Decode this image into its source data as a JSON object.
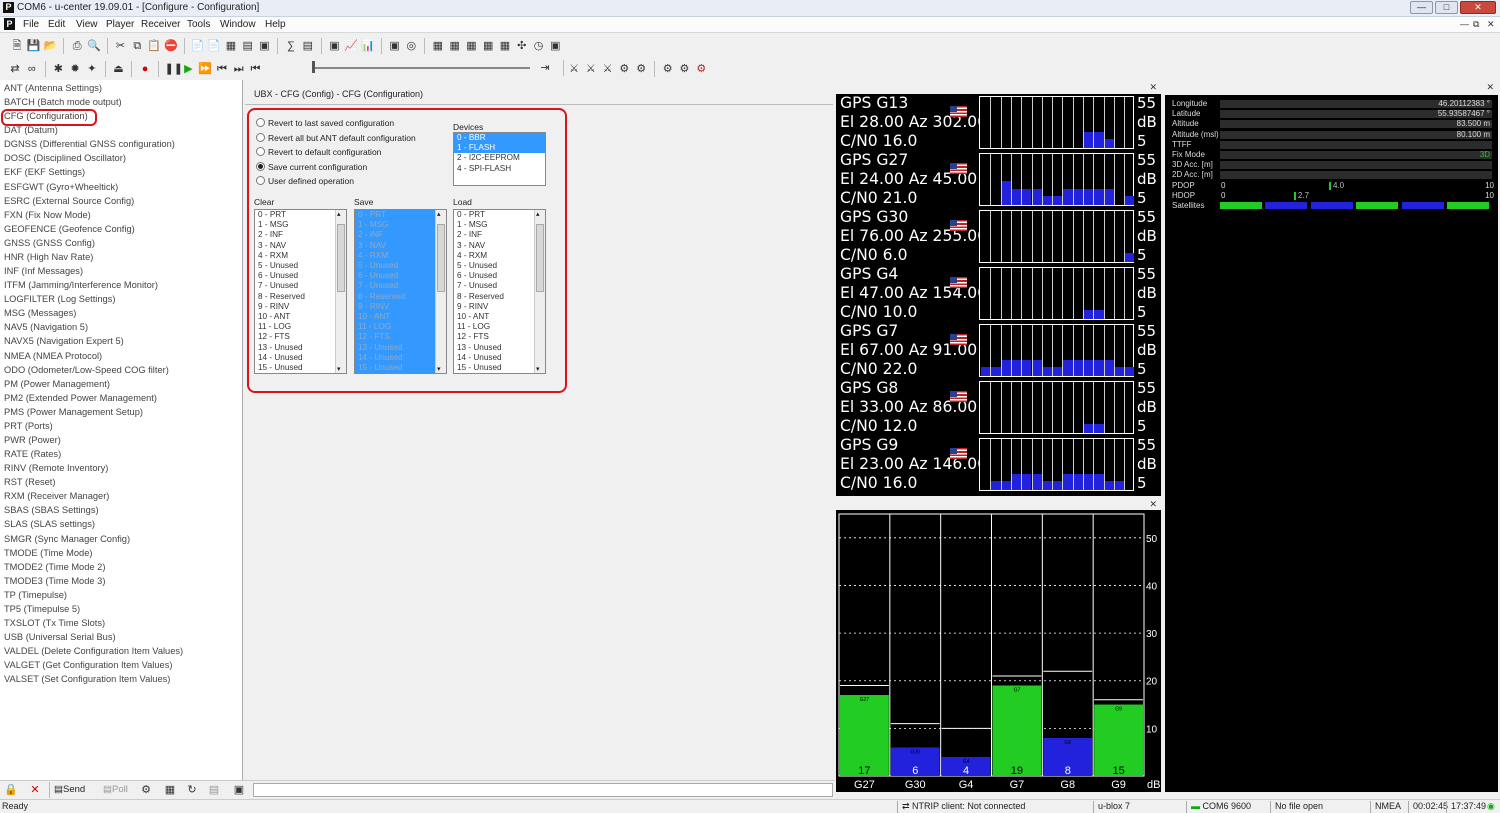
{
  "window": {
    "title": "COM6 - u-center 19.09.01 - [Configure - Configuration]"
  },
  "menu": [
    "File",
    "Edit",
    "View",
    "Player",
    "Receiver",
    "Tools",
    "Window",
    "Help"
  ],
  "tree": [
    "ANT (Antenna Settings)",
    "BATCH (Batch mode output)",
    "CFG (Configuration)",
    "DAT (Datum)",
    "DGNSS (Differential GNSS configuration)",
    "DOSC (Disciplined Oscillator)",
    "EKF (EKF Settings)",
    "ESFGWT (Gyro+Wheeltick)",
    "ESRC (External Source Config)",
    "FXN (Fix Now Mode)",
    "GEOFENCE (Geofence Config)",
    "GNSS (GNSS Config)",
    "HNR (High Nav Rate)",
    "INF (Inf Messages)",
    "ITFM (Jamming/Interference Monitor)",
    "LOGFILTER (Log Settings)",
    "MSG (Messages)",
    "NAV5 (Navigation 5)",
    "NAVX5 (Navigation Expert 5)",
    "NMEA (NMEA Protocol)",
    "ODO (Odometer/Low-Speed COG filter)",
    "PM (Power Management)",
    "PM2 (Extended Power Management)",
    "PMS (Power Management Setup)",
    "PRT (Ports)",
    "PWR (Power)",
    "RATE (Rates)",
    "RINV (Remote Inventory)",
    "RST (Reset)",
    "RXM (Receiver Manager)",
    "SBAS (SBAS Settings)",
    "SLAS (SLAS settings)",
    "SMGR (Sync Manager Config)",
    "TMODE (Time Mode)",
    "TMODE2 (Time Mode 2)",
    "TMODE3 (Time Mode 3)",
    "TP (Timepulse)",
    "TP5 (Timepulse 5)",
    "TXSLOT (Tx Time Slots)",
    "USB (Universal Serial Bus)",
    "VALDEL (Delete Configuration Item Values)",
    "VALGET (Get Configuration Item Values)",
    "VALSET (Set Configuration Item Values)"
  ],
  "config": {
    "header": "UBX - CFG (Config) - CFG (Configuration)",
    "options": [
      {
        "label": "Revert to last saved configuration",
        "selected": false
      },
      {
        "label": "Revert all but ANT default configuration",
        "selected": false
      },
      {
        "label": "Revert to default configuration",
        "selected": false
      },
      {
        "label": "Save current configuration",
        "selected": true
      },
      {
        "label": "User defined operation",
        "selected": false
      }
    ],
    "devices_label": "Devices",
    "devices": [
      {
        "label": "0 - BBR",
        "selected": true
      },
      {
        "label": "1 - FLASH",
        "selected": true
      },
      {
        "label": "2 - I2C-EEPROM",
        "selected": false
      },
      {
        "label": "4 - SPI-FLASH",
        "selected": false
      }
    ],
    "clear_label": "Clear",
    "save_label": "Save",
    "load_label": "Load",
    "sections": [
      "0 - PRT",
      "1 - MSG",
      "2 - INF",
      "3 - NAV",
      "4 - RXM",
      "5 - Unused",
      "6 - Unused",
      "7 - Unused",
      "8 - Reserved",
      "9 - RINV",
      "10 - ANT",
      "11 - LOG",
      "12 - FTS",
      "13 - Unused",
      "14 - Unused",
      "15 - Unused"
    ]
  },
  "satellites": [
    {
      "name": "GPS G13",
      "el_az": "El 28.00 Az 302.00",
      "cn0": "C/N0 16.0"
    },
    {
      "name": "GPS G27",
      "el_az": "El 24.00 Az 45.00",
      "cn0": "C/N0 21.0"
    },
    {
      "name": "GPS G30",
      "el_az": "El 76.00 Az 255.00",
      "cn0": "C/N0 6.0"
    },
    {
      "name": "GPS G4",
      "el_az": "El 47.00 Az 154.00",
      "cn0": "C/N0 10.0"
    },
    {
      "name": "GPS G7",
      "el_az": "El 67.00 Az 91.00",
      "cn0": "C/N0 22.0"
    },
    {
      "name": "GPS G8",
      "el_az": "El 33.00 Az 86.00",
      "cn0": "C/N0 12.0"
    },
    {
      "name": "GPS G9",
      "el_az": "El 23.00 Az 146.00",
      "cn0": "C/N0 16.0"
    }
  ],
  "sat_scale": {
    "top": "55",
    "unit": "dB",
    "bottom": "5"
  },
  "info": {
    "rows": [
      {
        "label": "Longitude",
        "value": "46.20112383 °"
      },
      {
        "label": "Latitude",
        "value": "55.93587467 °"
      },
      {
        "label": "Altitude",
        "value": "83.500 m"
      },
      {
        "label": "Altitude (msl)",
        "value": "80.100 m"
      },
      {
        "label": "TTFF",
        "value": ""
      },
      {
        "label": "Fix Mode",
        "value": "3D"
      },
      {
        "label": "3D Acc. [m]",
        "value": ""
      },
      {
        "label": "2D Acc. [m]",
        "value": ""
      }
    ],
    "pdop": {
      "label": "PDOP",
      "min": "0",
      "max": "10",
      "value": "4.0"
    },
    "hdop": {
      "label": "HDOP",
      "min": "0",
      "max": "10",
      "value": "2.7"
    },
    "satellites_label": "Satellites"
  },
  "chart_data": {
    "type": "bar",
    "categories": [
      "G27",
      "G30",
      "G4",
      "G7",
      "G8",
      "G9"
    ],
    "values": [
      17,
      6,
      4,
      19,
      8,
      15
    ],
    "value_labels": [
      "17",
      "6",
      "4",
      "19",
      "8",
      "15"
    ],
    "ylabel": "dB",
    "yticks": [
      "50",
      "40",
      "30",
      "20",
      "10"
    ],
    "ylim": [
      0,
      55
    ],
    "colors": [
      "#22cc22",
      "#2222dd",
      "#2222dd",
      "#22cc22",
      "#2222dd",
      "#22cc22"
    ],
    "white_lines": [
      19,
      11,
      10,
      21,
      22,
      16
    ]
  },
  "bottom_toolbar": {
    "send": "Send",
    "poll": "Poll"
  },
  "status": {
    "ready": "Ready",
    "ntrip": "NTRIP client: Not connected",
    "receiver": "u-blox 7",
    "port": "COM6 9600",
    "file": "No file open",
    "protocol": "NMEA",
    "elapsed": "00:02:45",
    "clock": "17:37:49"
  },
  "colors": {
    "highlight": "#d8141c",
    "selection": "#3399ff",
    "strong": "#22cc22",
    "weak": "#2222dd"
  }
}
